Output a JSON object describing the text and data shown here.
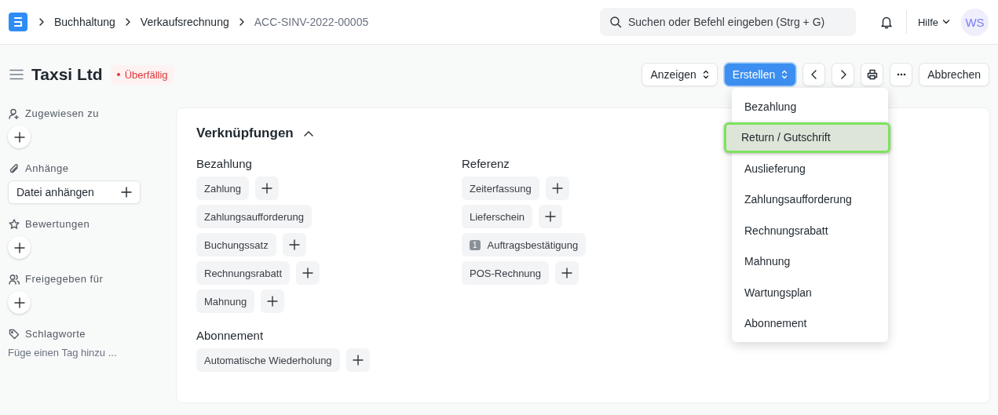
{
  "breadcrumbs": [
    {
      "label": "Buchhaltung",
      "current": false
    },
    {
      "label": "Verkaufsrechnung",
      "current": false
    },
    {
      "label": "ACC-SINV-2022-00005",
      "current": true
    }
  ],
  "search": {
    "placeholder": "Suchen oder Befehl eingeben (Strg + G)"
  },
  "help": "Hilfe",
  "avatar": "WS",
  "title": "Taxsi Ltd",
  "status": {
    "label": "Überfällig",
    "color": "#e03636"
  },
  "actions": [
    {
      "kind": "dropdown",
      "label": "Anzeigen",
      "primary": false
    },
    {
      "kind": "dropdown",
      "label": "Erstellen",
      "primary": true
    },
    {
      "kind": "prev"
    },
    {
      "kind": "next"
    },
    {
      "kind": "print"
    },
    {
      "kind": "more"
    },
    {
      "kind": "text",
      "label": "Abbrechen",
      "primary": false
    }
  ],
  "menu": {
    "items": [
      {
        "label": "Bezahlung",
        "selected": false
      },
      {
        "label": "Return / Gutschrift",
        "selected": true
      },
      {
        "label": "Auslieferung",
        "selected": false
      },
      {
        "label": "Zahlungsaufforderung",
        "selected": false
      },
      {
        "label": "Rechnungsrabatt",
        "selected": false
      },
      {
        "label": "Mahnung",
        "selected": false
      },
      {
        "label": "Wartungsplan",
        "selected": false
      },
      {
        "label": "Abonnement",
        "selected": false
      }
    ]
  },
  "sidebar": [
    {
      "kind": "assign",
      "label": "Zugewiesen zu"
    },
    {
      "kind": "attach",
      "label": "Anhänge",
      "button": "Datei anhängen"
    },
    {
      "kind": "rating",
      "label": "Bewertungen"
    },
    {
      "kind": "share",
      "label": "Freigegeben für"
    },
    {
      "kind": "tags",
      "label": "Schlagworte",
      "placeholder": "Füge einen Tag hinzu ..."
    }
  ],
  "links": {
    "title": "Verknüpfungen",
    "expanded": true,
    "columns": [
      {
        "groups": [
          {
            "title": "Bezahlung",
            "items": [
              {
                "label": "Zahlung",
                "has_add": true
              },
              {
                "label": "Zahlungsaufforderung",
                "has_add": false
              },
              {
                "label": "Buchungssatz",
                "has_add": true
              },
              {
                "label": "Rechnungsrabatt",
                "has_add": true
              },
              {
                "label": "Mahnung",
                "has_add": true
              }
            ]
          },
          {
            "title": "Abonnement",
            "items": [
              {
                "label": "Automatische Wiederholung",
                "has_add": true
              }
            ]
          }
        ]
      },
      {
        "groups": [
          {
            "title": "Referenz",
            "items": [
              {
                "label": "Zeiterfassung",
                "has_add": true
              },
              {
                "label": "Lieferschein",
                "has_add": true
              },
              {
                "label": "Auftragsbestätigung",
                "count": "1",
                "has_add": false
              },
              {
                "label": "POS-Rechnung",
                "has_add": true
              }
            ]
          }
        ]
      }
    ]
  }
}
